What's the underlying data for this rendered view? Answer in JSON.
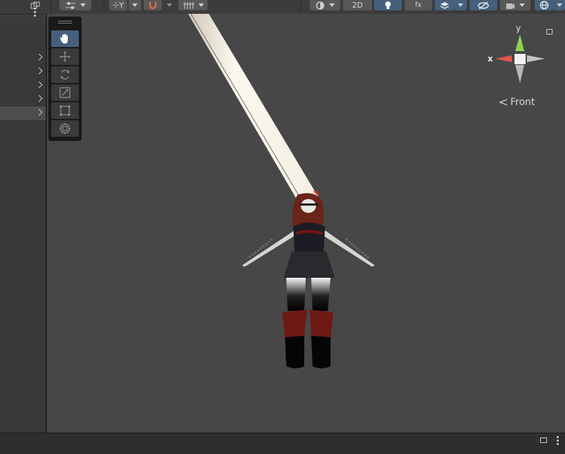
{
  "toolbar": {
    "pivot_label": "⊹Y",
    "mode_2d_label": "2D",
    "fx_label": "fx"
  },
  "hierarchy": {
    "selected_row": 4,
    "rows": [
      "",
      "",
      "",
      "",
      ""
    ]
  },
  "tools": [
    "hand",
    "move",
    "rotate",
    "scale",
    "rect",
    "transform"
  ],
  "active_tool": "hand",
  "gizmo": {
    "y_label": "y",
    "x_label": "x",
    "view_label": "Front"
  },
  "colors": {
    "active_blue": "#46607c",
    "gizmo_y": "#8fd14f",
    "gizmo_x": "#e0564a"
  }
}
